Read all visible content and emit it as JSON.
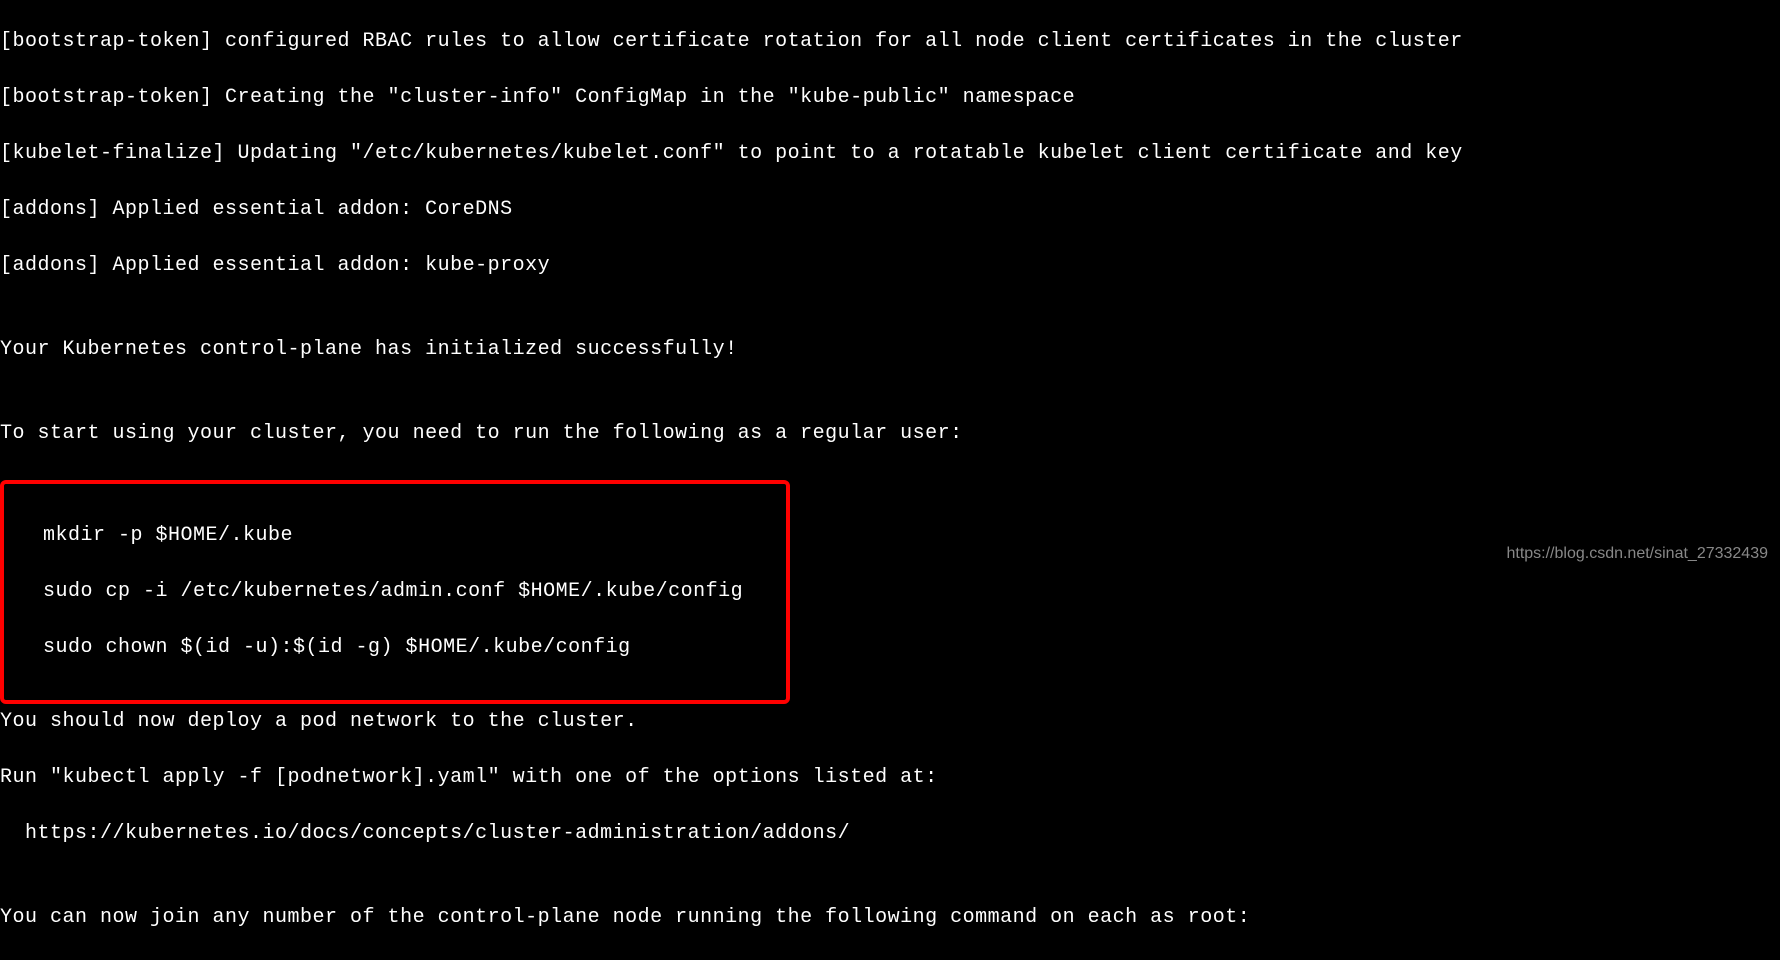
{
  "lines": {
    "l1": "[bootstrap-token] configured RBAC rules to allow certificate rotation for all node client certificates in the cluster",
    "l2": "[bootstrap-token] Creating the \"cluster-info\" ConfigMap in the \"kube-public\" namespace",
    "l3": "[kubelet-finalize] Updating \"/etc/kubernetes/kubelet.conf\" to point to a rotatable kubelet client certificate and key",
    "l4": "[addons] Applied essential addon: CoreDNS",
    "l5": "[addons] Applied essential addon: kube-proxy",
    "l6": "",
    "l7": "Your Kubernetes control-plane has initialized successfully!",
    "l8": "",
    "l9": "To start using your cluster, you need to run the following as a regular user:",
    "l10": "",
    "box1": "  mkdir -p $HOME/.kube",
    "box2": "  sudo cp -i /etc/kubernetes/admin.conf $HOME/.kube/config",
    "box3": "  sudo chown $(id -u):$(id -g) $HOME/.kube/config",
    "l11": "",
    "l12": "You should now deploy a pod network to the cluster.",
    "l13": "Run \"kubectl apply -f [podnetwork].yaml\" with one of the options listed at:",
    "l14": "  https://kubernetes.io/docs/concepts/cluster-administration/addons/",
    "l15": "",
    "l16": "You can now join any number of the control-plane node running the following command on each as root:"
  },
  "watermark": "https://blog.csdn.net/sinat_27332439"
}
